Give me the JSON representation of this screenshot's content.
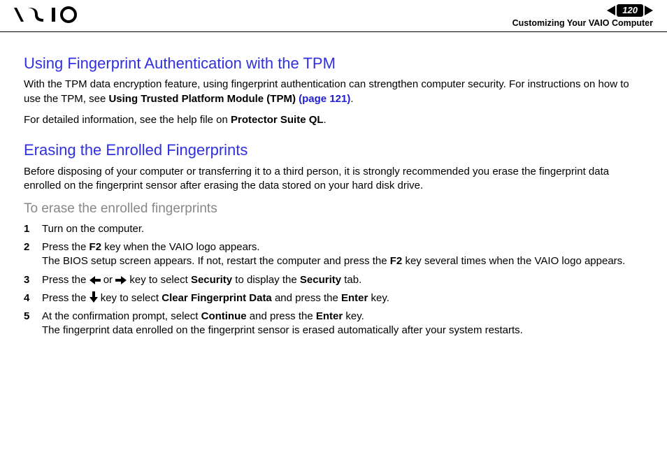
{
  "header": {
    "page_number": "120",
    "breadcrumb": "Customizing Your VAIO Computer"
  },
  "sections": {
    "tpm": {
      "heading": "Using Fingerprint Authentication with the TPM",
      "p1_a": "With the TPM data encryption feature, using fingerprint authentication can strengthen computer security. For instructions on how to use the TPM, see ",
      "p1_bold": "Using Trusted Platform Module (TPM)",
      "p1_link": "(page 121)",
      "p1_end": ".",
      "p2_a": "For detailed information, see the help file on ",
      "p2_bold": "Protector Suite QL",
      "p2_end": "."
    },
    "erase": {
      "heading": "Erasing the Enrolled Fingerprints",
      "p1": "Before disposing of your computer or transferring it to a third person, it is strongly recommended you erase the fingerprint data enrolled on the fingerprint sensor after erasing the data stored on your hard disk drive.",
      "subheading": "To erase the enrolled fingerprints",
      "steps": {
        "n1": "1",
        "s1": "Turn on the computer.",
        "n2": "2",
        "s2a": "Press the ",
        "s2_f2": "F2",
        "s2b": " key when the VAIO logo appears.",
        "s2c": "The BIOS setup screen appears. If not, restart the computer and press the ",
        "s2_f2b": "F2",
        "s2d": " key several times when the VAIO logo appears.",
        "n3": "3",
        "s3a": "Press the ",
        "s3b": " or ",
        "s3c": " key to select ",
        "s3_sec1": "Security",
        "s3d": " to display the ",
        "s3_sec2": "Security",
        "s3e": " tab.",
        "n4": "4",
        "s4a": "Press the ",
        "s4b": " key to select ",
        "s4_clear": "Clear Fingerprint Data",
        "s4c": " and press the ",
        "s4_enter": "Enter",
        "s4d": " key.",
        "n5": "5",
        "s5a": "At the confirmation prompt, select ",
        "s5_cont": "Continue",
        "s5b": " and press the ",
        "s5_enter": "Enter",
        "s5c": " key.",
        "s5d": "The fingerprint data enrolled on the fingerprint sensor is erased automatically after your system restarts."
      }
    }
  }
}
